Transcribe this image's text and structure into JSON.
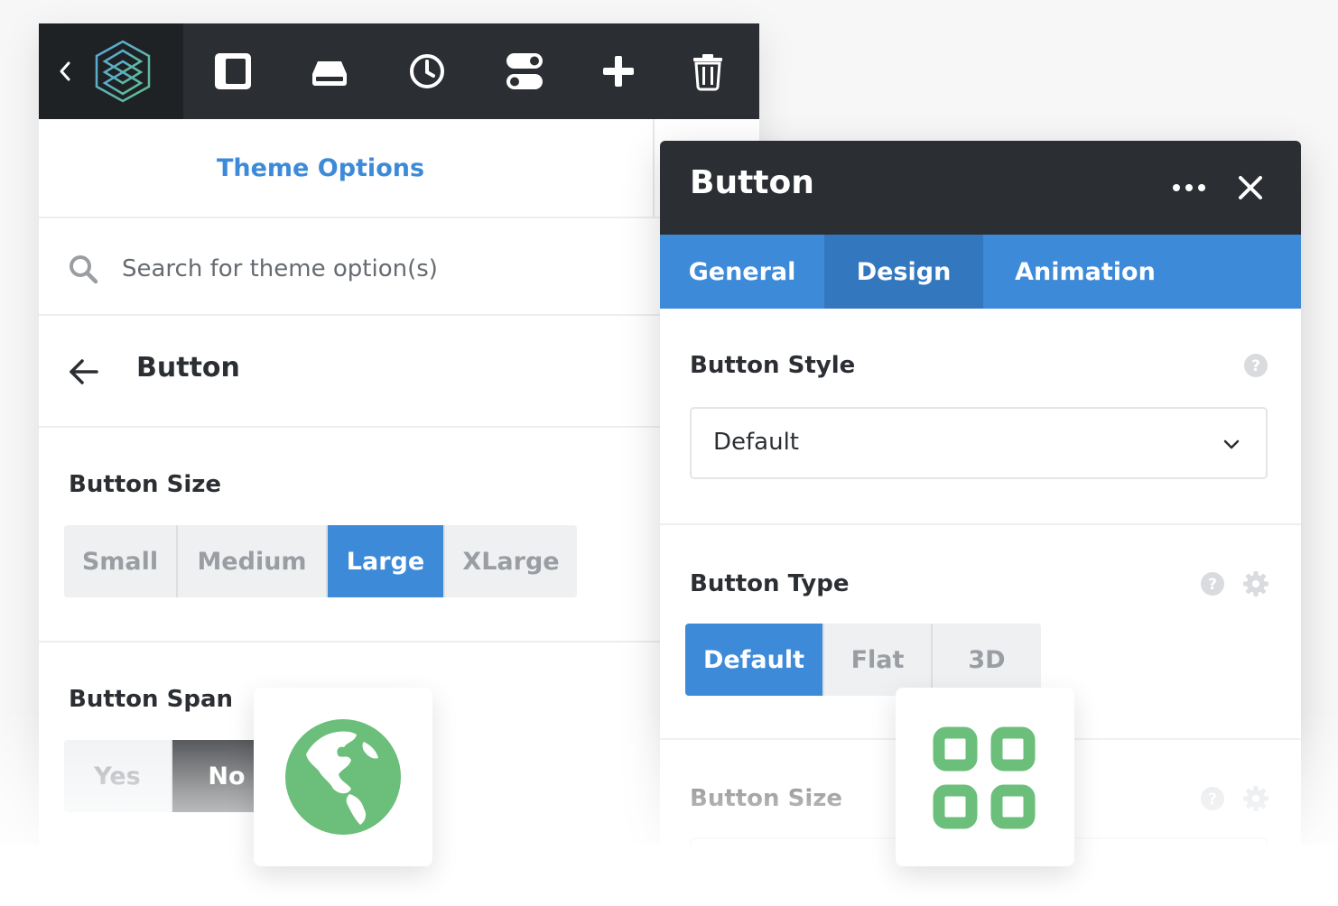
{
  "toolbar": {
    "icons": [
      "chevron-left-icon",
      "logo",
      "sidebar-toggle-icon",
      "drive-icon",
      "clock-icon",
      "toggles-icon",
      "plus-icon",
      "trash-icon"
    ]
  },
  "left_panel": {
    "title": "Theme Options",
    "search": {
      "placeholder": "Search for theme option(s)",
      "value": ""
    },
    "section_title": "Button",
    "button_size": {
      "label": "Button Size",
      "options": [
        "Small",
        "Medium",
        "Large",
        "XLarge"
      ],
      "selected": "Large"
    },
    "button_span": {
      "label": "Button Span",
      "options": [
        "Yes",
        "No"
      ],
      "selected": "No"
    }
  },
  "right_panel": {
    "title": "Button",
    "tabs": [
      "General",
      "Design",
      "Animation"
    ],
    "active_tab": "Design",
    "button_style": {
      "label": "Button Style",
      "value": "Default"
    },
    "button_type": {
      "label": "Button Type",
      "options": [
        "Default",
        "Flat",
        "3D"
      ],
      "selected": "Default"
    },
    "button_size": {
      "label": "Button Size"
    }
  },
  "colors": {
    "accent_blue": "#3d8ad9",
    "dark": "#2b2e32",
    "green": "#6bbf7a"
  },
  "floating_tiles": [
    "globe-icon",
    "grid-icon"
  ]
}
